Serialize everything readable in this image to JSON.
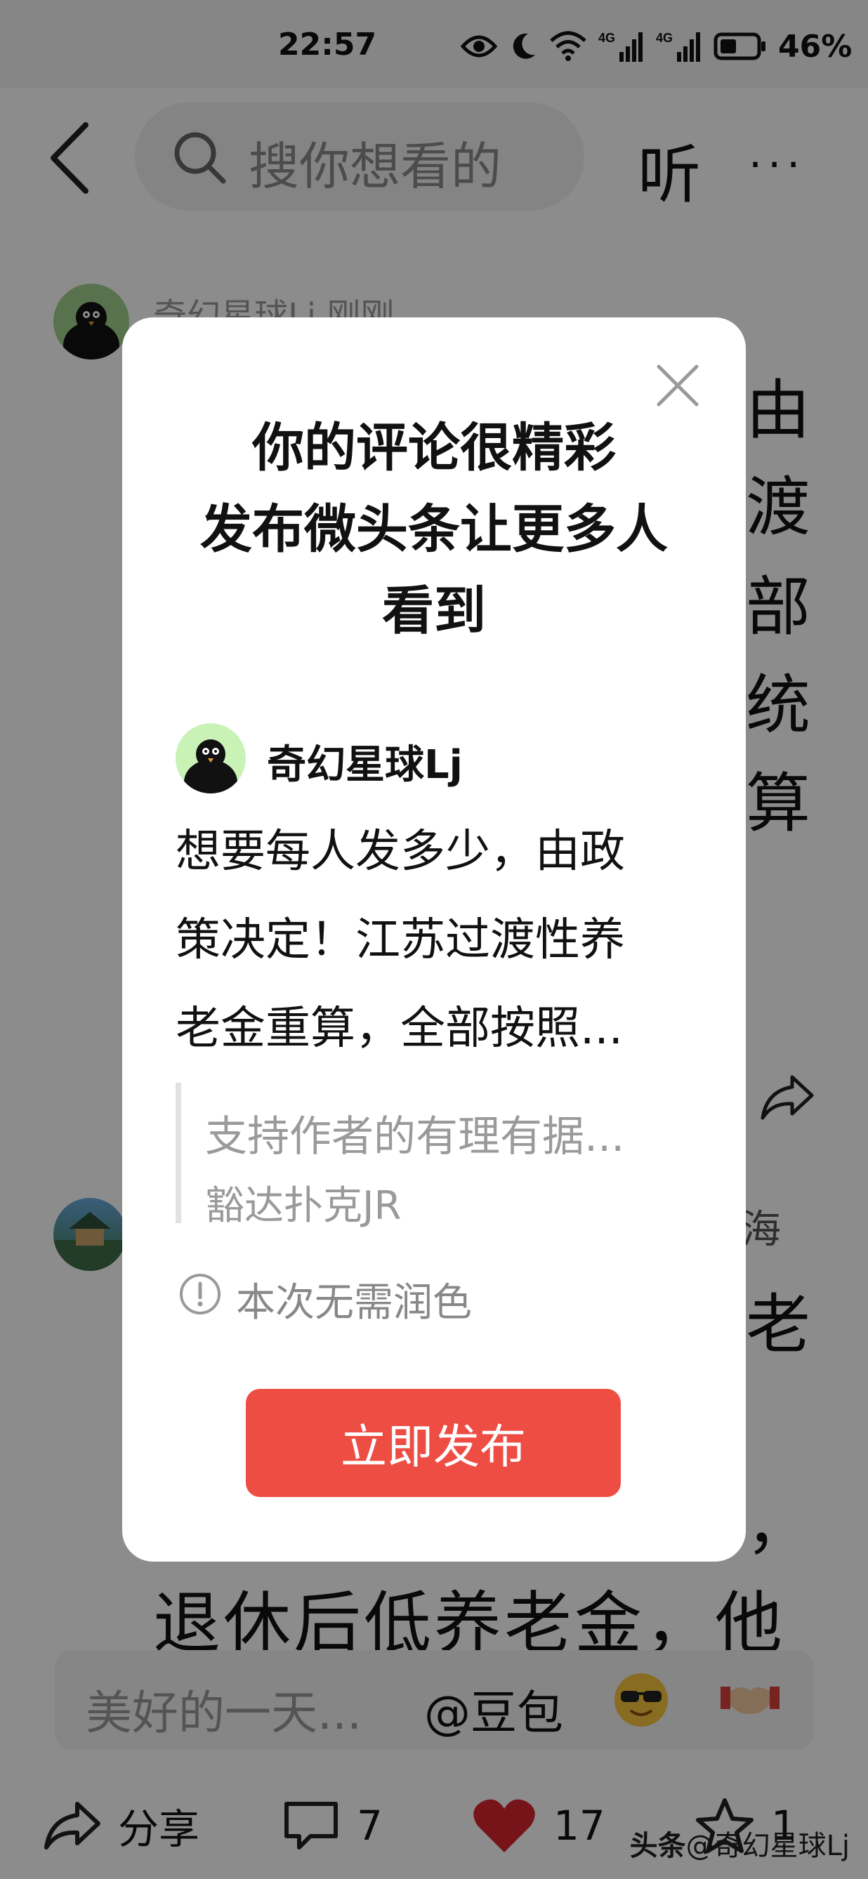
{
  "status_bar": {
    "time": "22:57",
    "battery": "46%",
    "network_1": "4G",
    "network_2": "4G",
    "icons": [
      "eye-icon",
      "moon-icon",
      "wifi-icon",
      "signal-4g-icon",
      "signal-4g-icon",
      "battery-icon"
    ]
  },
  "top_nav": {
    "search_placeholder": "搜你想看的",
    "listen_label": "听",
    "more_label": "···"
  },
  "feed": {
    "post1_meta": "奇幻星球Lj  刚刚",
    "post1_edge_chars": [
      "由",
      "渡",
      "部",
      "统",
      "算"
    ],
    "post2_edge_char_1": "海",
    "post2_edge_char_2": "老",
    "edge_comma": "，",
    "bottom_line": "退休后低养老金，他"
  },
  "comment_bar": {
    "placeholder": "美好的一天...",
    "mention": "@豆包"
  },
  "actions": {
    "share_label": "分享",
    "comments_count": "7",
    "likes_count": "17",
    "favorites_count": "1"
  },
  "watermark": {
    "logo": "头条",
    "author": "@奇幻星球Lj"
  },
  "dialog": {
    "title_lines": [
      "你的评论很精彩",
      "发布微头条让更多人",
      "看到"
    ],
    "author": "奇幻星球Lj",
    "body_lines": [
      "想要每人发多少，由政",
      "策决定！江苏过渡性养",
      "老金重算，全部按照..."
    ],
    "quote_text": "支持作者的有理有据...",
    "quote_author": "豁达扑克JR",
    "notice": "本次无需润色",
    "publish_button": "立即发布"
  },
  "colors": {
    "accent": "#ee4d44",
    "like": "#d8262f",
    "overlay": "rgba(0,0,0,0.45)"
  }
}
